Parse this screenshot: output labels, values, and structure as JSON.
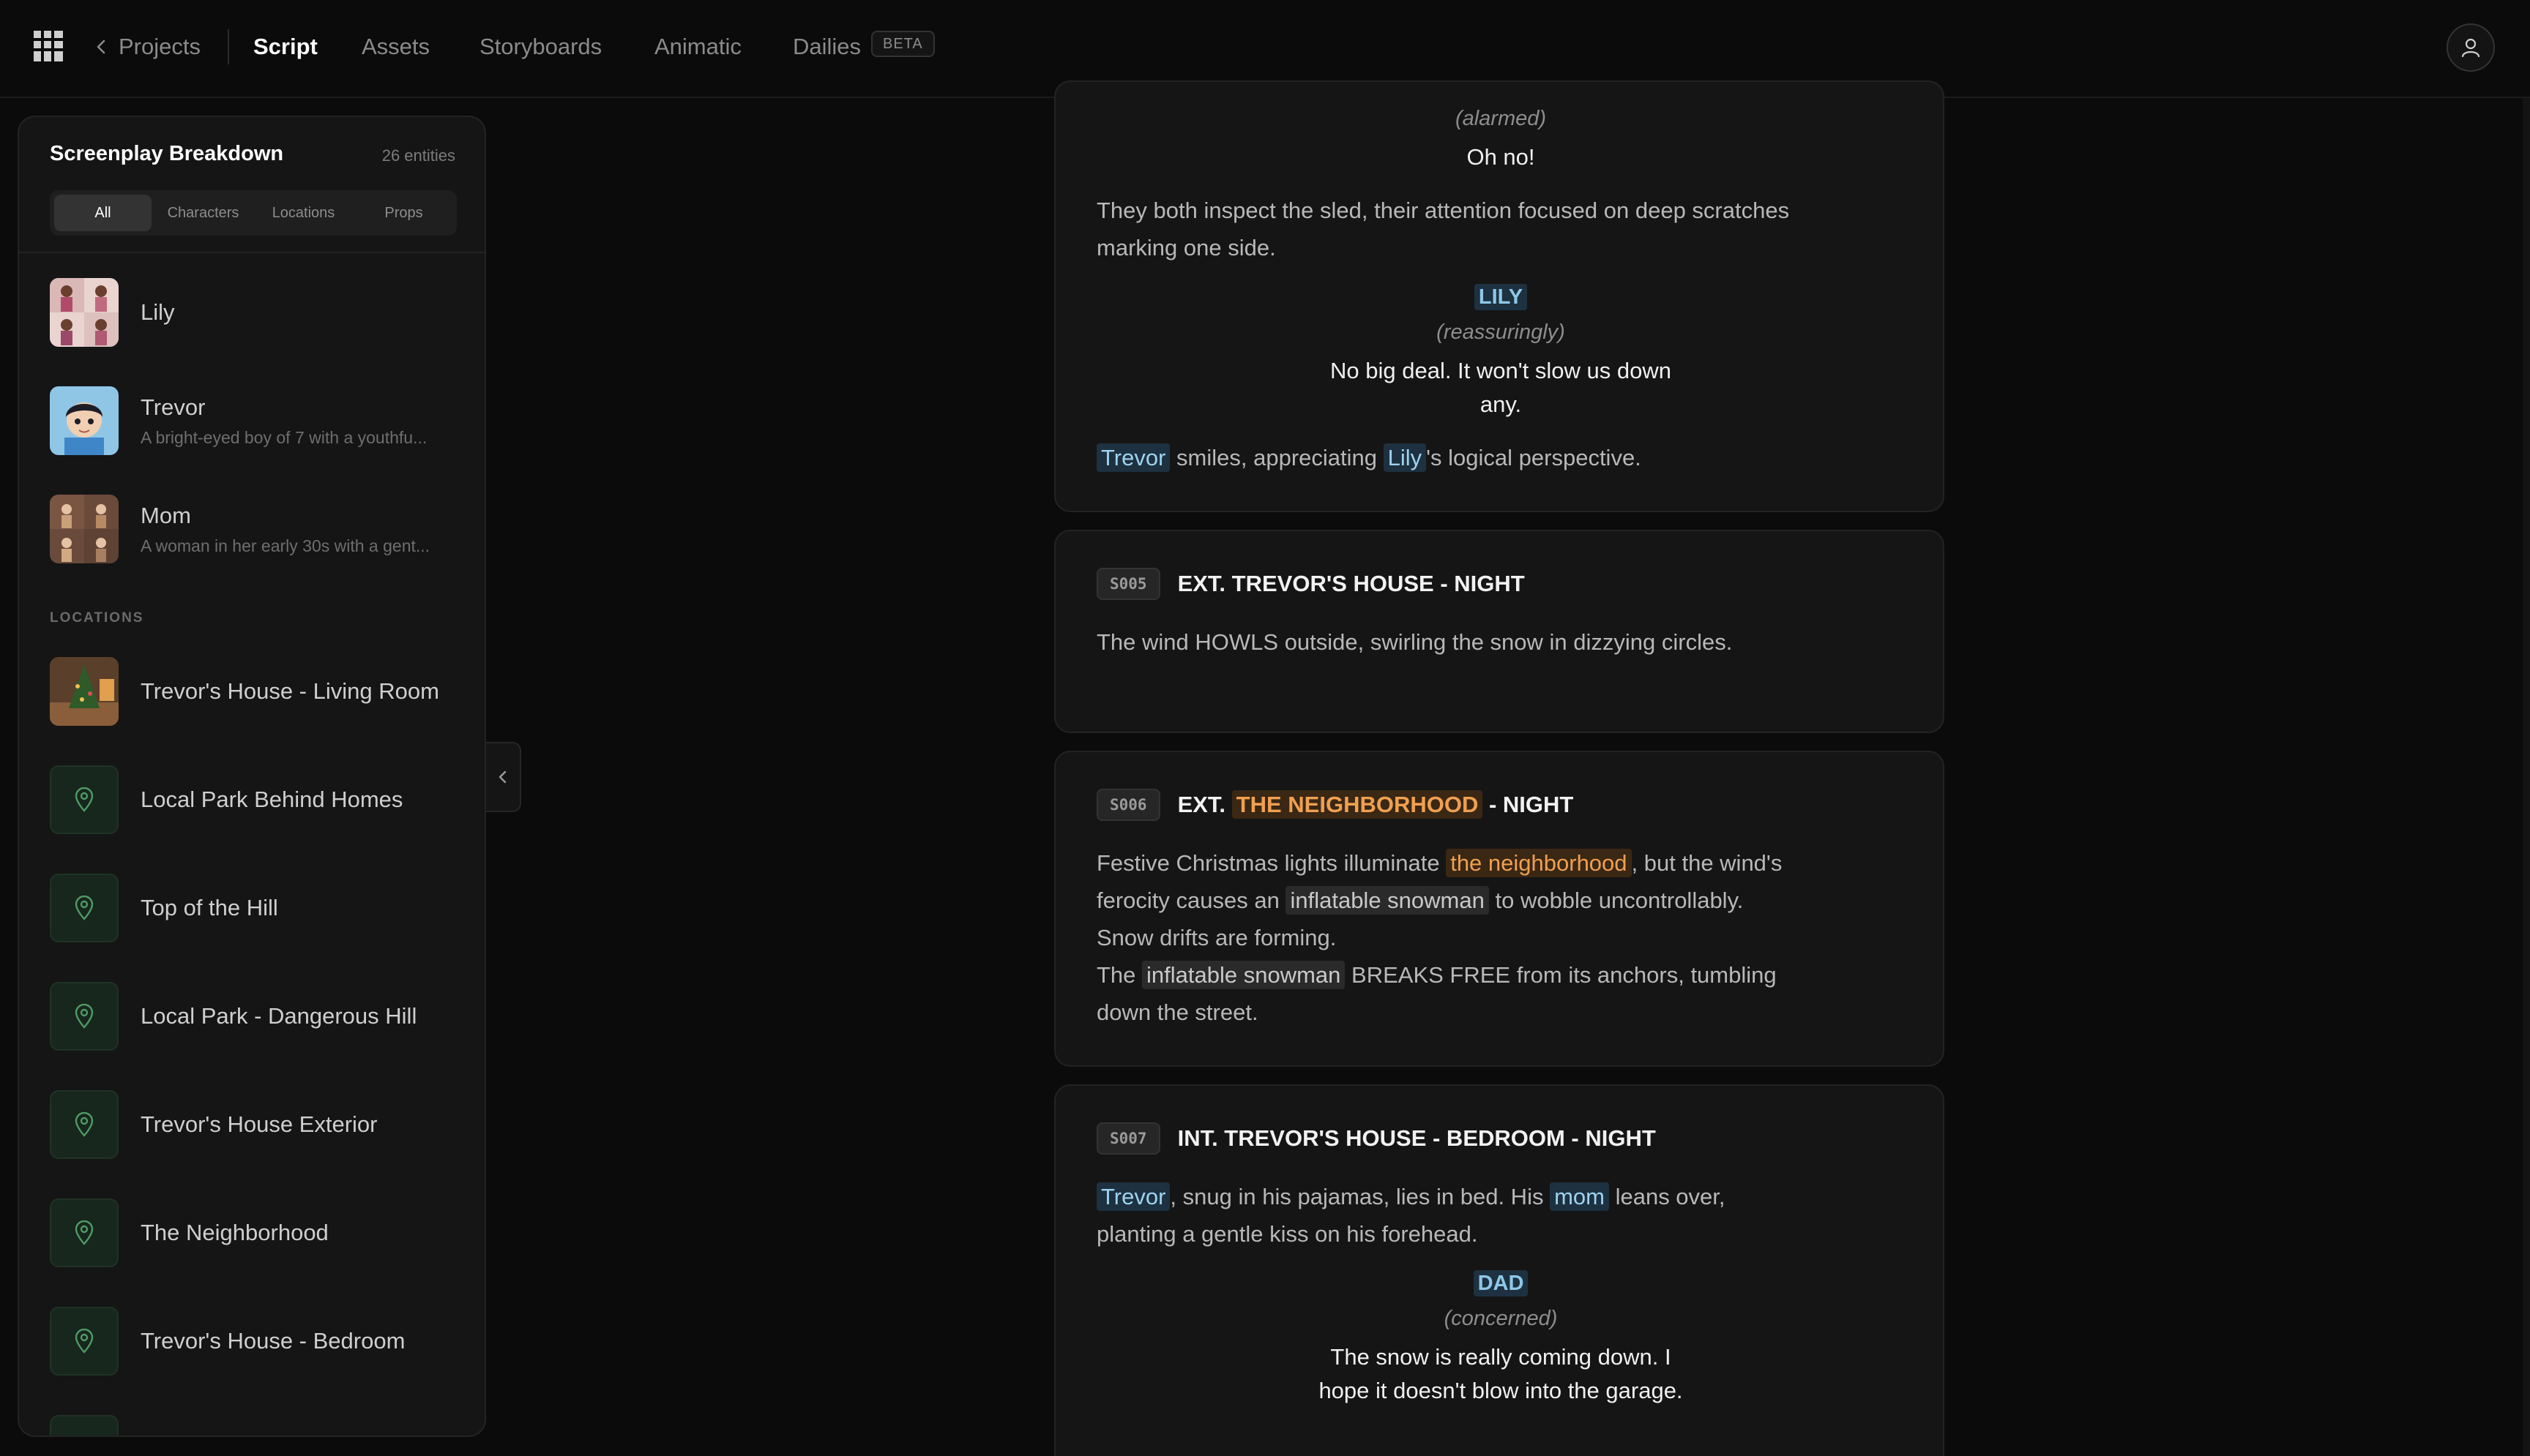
{
  "nav": {
    "back_label": "Projects",
    "tabs": [
      "Script",
      "Assets",
      "Storyboards",
      "Animatic",
      "Dailies"
    ],
    "active_tab": "Script",
    "beta_label": "BETA"
  },
  "sidebar": {
    "title": "Screenplay Breakdown",
    "count": "26 entities",
    "filters": [
      "All",
      "Characters",
      "Locations",
      "Props"
    ],
    "active_filter": "All",
    "characters": [
      {
        "name": "Lily",
        "desc": ""
      },
      {
        "name": "Trevor",
        "desc": "A bright-eyed boy of 7 with a youthfu..."
      },
      {
        "name": "Mom",
        "desc": "A woman in her early 30s with a gent..."
      }
    ],
    "locations_header": "LOCATIONS",
    "locations": [
      "Trevor's House - Living Room",
      "Local Park Behind Homes",
      "Top of the Hill",
      "Local Park - Dangerous Hill",
      "Trevor's House Exterior",
      "The Neighborhood",
      "Trevor's House - Bedroom"
    ]
  },
  "script": {
    "card1": {
      "paren1": "(alarmed)",
      "dialog1": "Oh no!",
      "action1": "They both inspect the sled, their attention focused on deep scratches marking one side.",
      "char": "LILY",
      "paren2": "(reassuringly)",
      "dialog2": "No big deal. It won't slow us down any.",
      "action2_char1": "Trevor",
      "action2_mid": " smiles, appreciating ",
      "action2_char2": "Lily",
      "action2_end": "'s logical perspective."
    },
    "s005": {
      "code": "S005",
      "heading": "EXT. TREVOR'S HOUSE - NIGHT",
      "action": "The wind HOWLS outside, swirling the snow in dizzying circles."
    },
    "s006": {
      "code": "S006",
      "heading_pre": "EXT. ",
      "heading_loc": "THE NEIGHBORHOOD",
      "heading_post": " - NIGHT",
      "a1": "Festive Christmas lights illuminate ",
      "a1_loc": "the neighborhood",
      "a2": ", but the wind's ferocity causes an ",
      "a2_prop": "inflatable snowman",
      "a3": " to wobble uncontrollably. Snow drifts are forming.",
      "b1": "The ",
      "b1_prop": "inflatable snowman",
      "b2": " BREAKS FREE from its anchors, tumbling down the street."
    },
    "s007": {
      "code": "S007",
      "heading": "INT. TREVOR'S HOUSE - BEDROOM - NIGHT",
      "a_char": "Trevor",
      "a1": ", snug in his pajamas, lies in bed. His ",
      "a_char2": "mom",
      "a2": " leans over, planting a gentle kiss on his forehead.",
      "char": "DAD",
      "paren": "(concerned)",
      "dialog": "The snow is really coming down. I hope it doesn't blow into the garage."
    }
  }
}
